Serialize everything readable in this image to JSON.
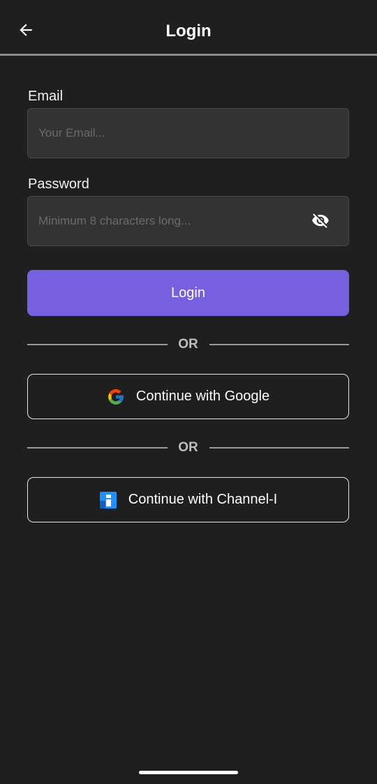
{
  "header": {
    "title": "Login",
    "back_icon": "arrow-left-icon"
  },
  "form": {
    "email_label": "Email",
    "email_placeholder": "Your Email...",
    "email_value": "",
    "password_label": "Password",
    "password_placeholder": "Minimum 8 characters long...",
    "password_value": "",
    "password_toggle_icon": "eye-off-icon",
    "login_label": "Login"
  },
  "social": {
    "or_text_1": "OR",
    "google_label": "Continue with Google",
    "google_icon": "google-icon",
    "or_text_2": "OR",
    "channel_label": "Continue with Channel-I",
    "channel_icon": "channel-i-icon"
  },
  "colors": {
    "background": "#1f1f1f",
    "input_background": "#333333",
    "primary": "#7660e0",
    "divider": "#9a9a9a"
  }
}
